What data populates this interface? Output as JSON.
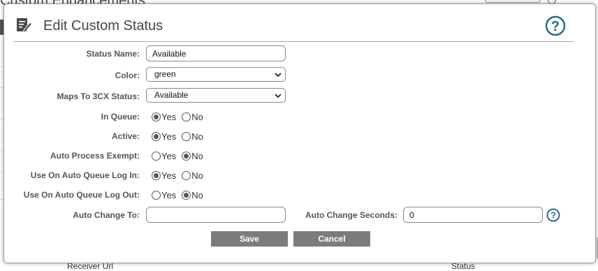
{
  "background": {
    "heading": "Custom Enhancements",
    "bottom_left_text": "Receiver Url",
    "bottom_right_text": "Status"
  },
  "modal": {
    "title": "Edit Custom Status",
    "header_icon": "edit-note-icon",
    "help_icon": "question-circle-icon"
  },
  "form": {
    "status_name": {
      "label": "Status Name:",
      "value": "Available"
    },
    "color": {
      "label": "Color:",
      "value": "green"
    },
    "maps_to": {
      "label": "Maps To 3CX Status:",
      "value": "Available"
    },
    "in_queue": {
      "label": "In Queue:",
      "yes": "Yes",
      "no": "No",
      "selected": "Yes"
    },
    "active": {
      "label": "Active:",
      "yes": "Yes",
      "no": "No",
      "selected": "Yes"
    },
    "auto_process_exempt": {
      "label": "Auto Process Exempt:",
      "yes": "Yes",
      "no": "No",
      "selected": "No"
    },
    "auto_queue_login": {
      "label": "Use On Auto Queue Log In:",
      "yes": "Yes",
      "no": "No",
      "selected": "Yes"
    },
    "auto_queue_logout": {
      "label": "Use On Auto Queue Log Out:",
      "yes": "Yes",
      "no": "No",
      "selected": "No"
    },
    "auto_change_to": {
      "label": "Auto Change To:",
      "value": ""
    },
    "auto_change_seconds": {
      "label": "Auto Change Seconds:",
      "value": "0"
    }
  },
  "buttons": {
    "save": "Save",
    "cancel": "Cancel"
  },
  "colors": {
    "button_bg": "#7c7c7c",
    "help_blue": "#2b6a8f",
    "header_rule": "#aaaaaa"
  }
}
